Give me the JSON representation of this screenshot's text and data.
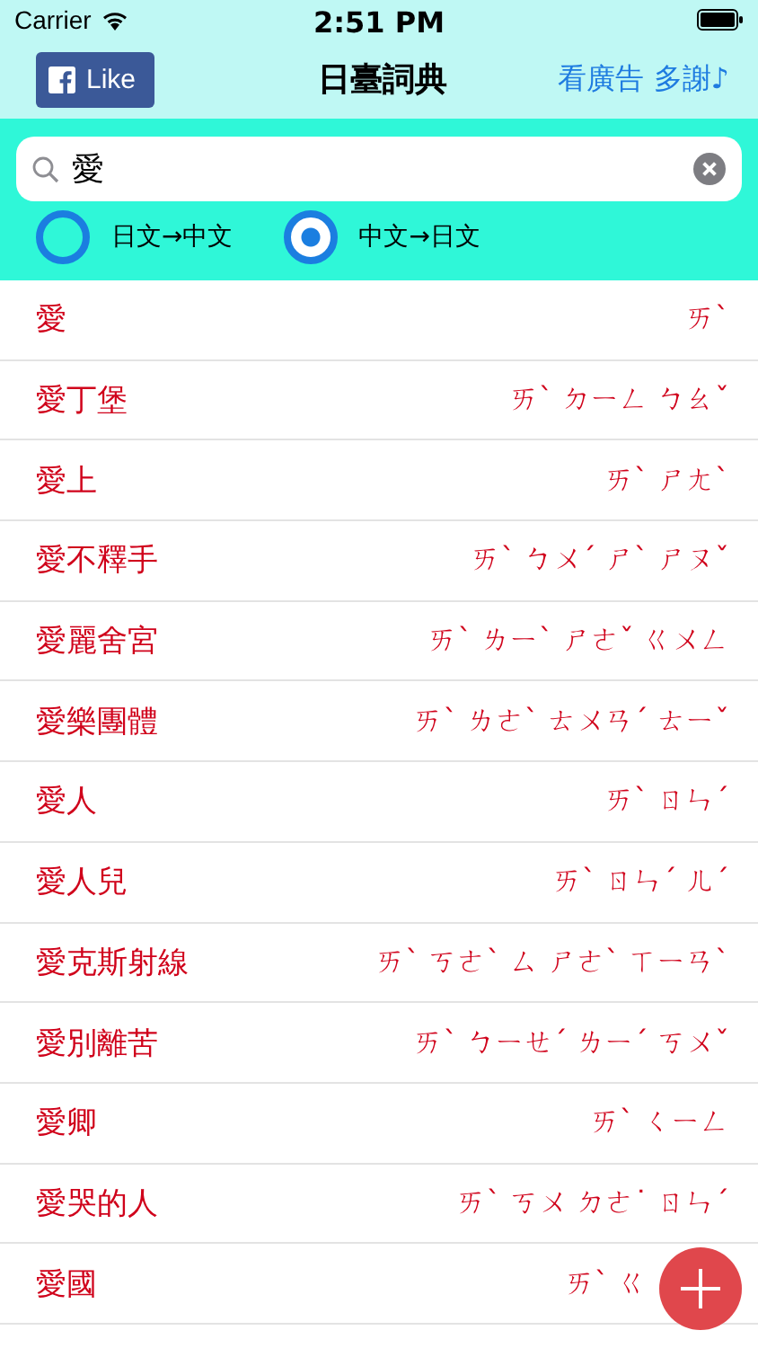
{
  "status_bar": {
    "carrier": "Carrier",
    "time": "2:51 PM"
  },
  "nav": {
    "like_button": "Like",
    "title": "日臺詞典",
    "ad_link": "看廣告 多謝♪"
  },
  "search": {
    "value": "愛"
  },
  "modes": [
    {
      "label": "日文→中文",
      "selected": false
    },
    {
      "label": "中文→日文",
      "selected": true
    }
  ],
  "entries": [
    {
      "word": "愛",
      "reading": "ㄞˋ"
    },
    {
      "word": "愛丁堡",
      "reading": "ㄞˋ ㄉㄧㄥ ㄅㄠˇ"
    },
    {
      "word": "愛上",
      "reading": "ㄞˋ ㄕㄤˋ"
    },
    {
      "word": "愛不釋手",
      "reading": "ㄞˋ ㄅㄨˊ ㄕˋ ㄕㄡˇ"
    },
    {
      "word": "愛麗舍宮",
      "reading": "ㄞˋ ㄌㄧˋ ㄕㄜˇ ㄍㄨㄥ"
    },
    {
      "word": "愛樂團體",
      "reading": "ㄞˋ ㄌㄜˋ ㄊㄨㄢˊ ㄊㄧˇ"
    },
    {
      "word": "愛人",
      "reading": "ㄞˋ ㄖㄣˊ"
    },
    {
      "word": "愛人兒",
      "reading": "ㄞˋ ㄖㄣˊ ㄦˊ"
    },
    {
      "word": "愛克斯射線",
      "reading": "ㄞˋ ㄎㄜˋ ㄙ ㄕㄜˋ ㄒㄧㄢˋ"
    },
    {
      "word": "愛別離苦",
      "reading": "ㄞˋ ㄅㄧㄝˊ ㄌㄧˊ ㄎㄨˇ"
    },
    {
      "word": "愛卿",
      "reading": "ㄞˋ ㄑㄧㄥ"
    },
    {
      "word": "愛哭的人",
      "reading": "ㄞˋ ㄎㄨ ㄉㄜ˙ ㄖㄣˊ"
    },
    {
      "word": "愛國",
      "reading": "ㄞˋ ㄍ"
    }
  ]
}
